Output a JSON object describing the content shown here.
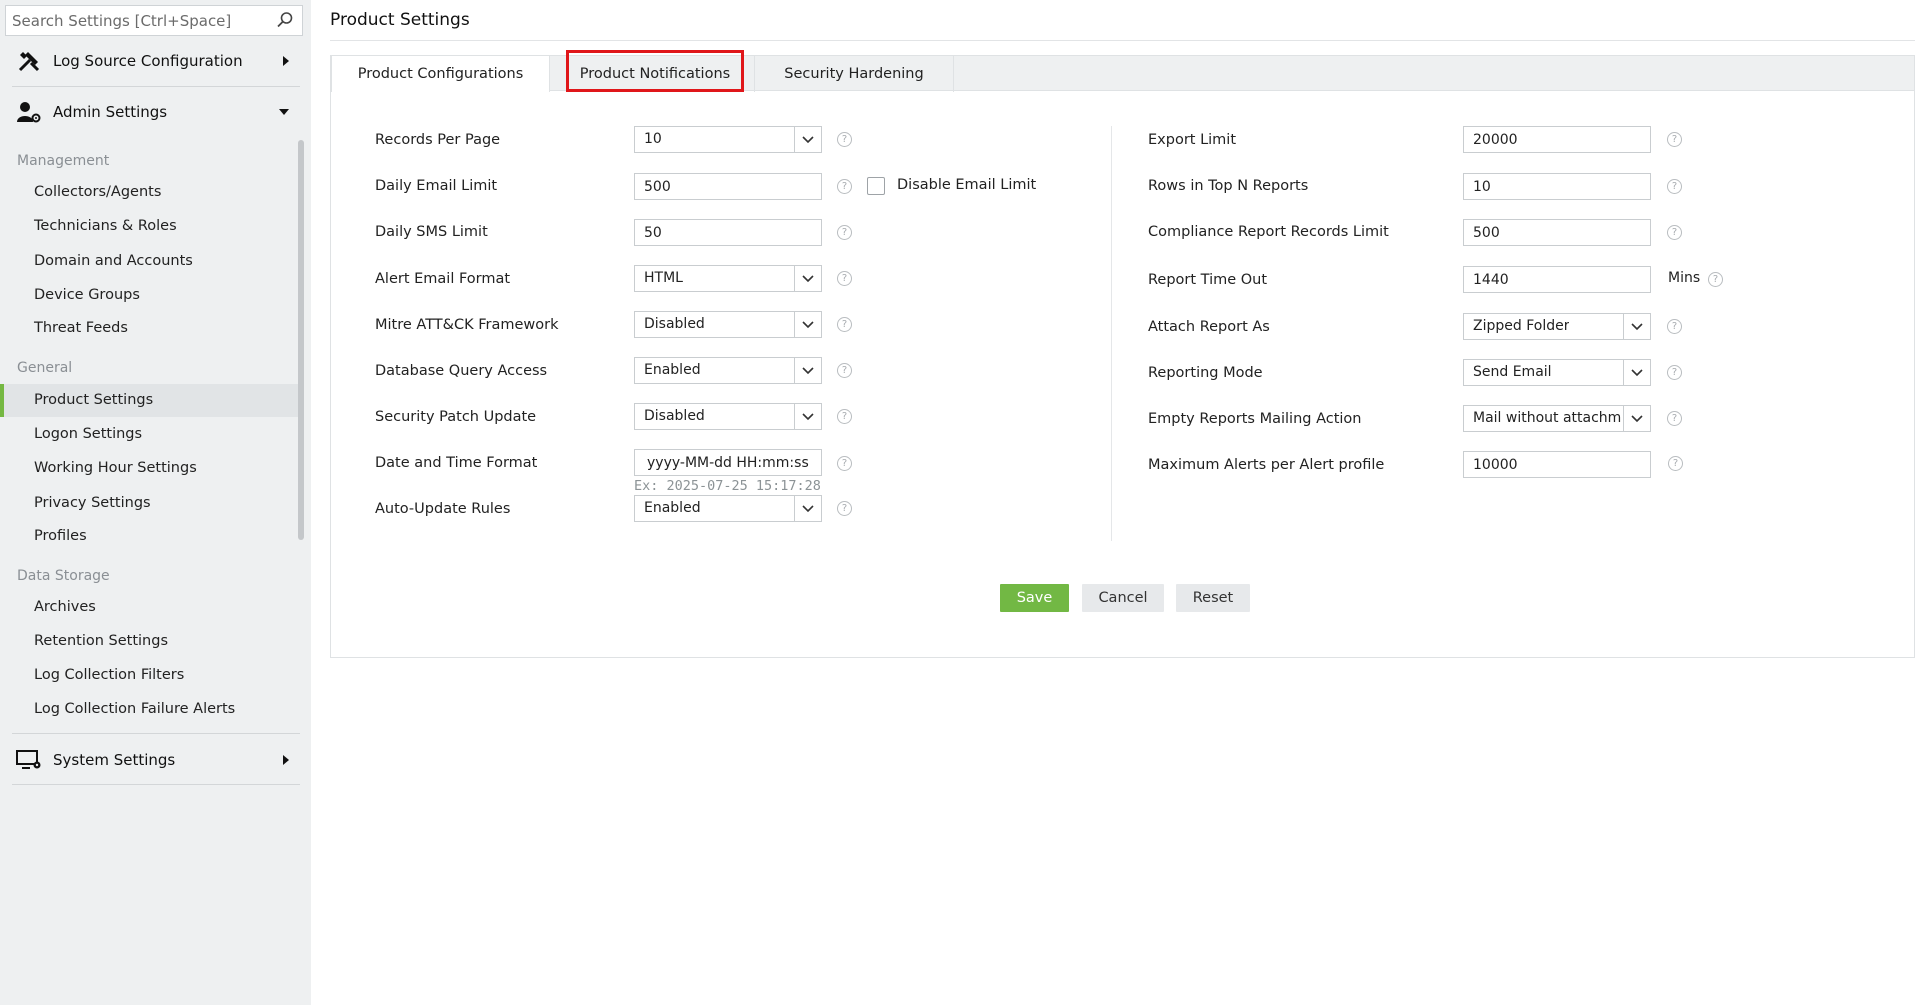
{
  "search": {
    "placeholder": "Search Settings [Ctrl+Space]"
  },
  "sidebar": {
    "log_source": {
      "label": "Log Source Configuration",
      "icon": "tools-icon"
    },
    "admin": {
      "label": "Admin Settings",
      "icon": "user-gear-icon"
    },
    "system": {
      "label": "System Settings",
      "icon": "monitor-gear-icon"
    },
    "sections": [
      {
        "label": "Management",
        "items": [
          "Collectors/Agents",
          "Technicians & Roles",
          "Domain and Accounts",
          "Device Groups",
          "Threat Feeds"
        ]
      },
      {
        "label": "General",
        "items": [
          "Product Settings",
          "Logon Settings",
          "Working Hour Settings",
          "Privacy Settings",
          "Profiles"
        ]
      },
      {
        "label": "Data Storage",
        "items": [
          "Archives",
          "Retention Settings",
          "Log Collection Filters",
          "Log Collection Failure Alerts"
        ]
      }
    ],
    "active_item": "Product Settings"
  },
  "page": {
    "title": "Product Settings"
  },
  "tabs": [
    "Product Configurations",
    "Product Notifications",
    "Security Hardening"
  ],
  "left_form": {
    "records_per_page": {
      "label": "Records Per Page",
      "value": "10"
    },
    "daily_email_limit": {
      "label": "Daily Email Limit",
      "value": "500",
      "checkbox_label": "Disable Email Limit",
      "checked": false
    },
    "daily_sms_limit": {
      "label": "Daily SMS Limit",
      "value": "50"
    },
    "alert_email_format": {
      "label": "Alert Email Format",
      "value": "HTML"
    },
    "mitre": {
      "label": "Mitre ATT&CK Framework",
      "value": "Disabled"
    },
    "db_query": {
      "label": "Database Query Access",
      "value": "Enabled"
    },
    "security_patch": {
      "label": "Security Patch Update",
      "value": "Disabled"
    },
    "date_format": {
      "label": "Date and Time Format",
      "value": "yyyy-MM-dd HH:mm:ss",
      "example": "Ex: 2025-07-25 15:17:28"
    },
    "auto_update": {
      "label": "Auto-Update Rules",
      "value": "Enabled"
    }
  },
  "right_form": {
    "export_limit": {
      "label": "Export Limit",
      "value": "20000"
    },
    "rows_top_n": {
      "label": "Rows in Top N Reports",
      "value": "10"
    },
    "compliance_limit": {
      "label": "Compliance Report Records Limit",
      "value": "500"
    },
    "report_timeout": {
      "label": "Report Time Out",
      "value": "1440",
      "unit": "Mins"
    },
    "attach_report": {
      "label": "Attach Report As",
      "value": "Zipped Folder"
    },
    "reporting_mode": {
      "label": "Reporting Mode",
      "value": "Send Email"
    },
    "empty_reports": {
      "label": "Empty Reports Mailing Action",
      "value": "Mail without attachm"
    },
    "max_alerts": {
      "label": "Maximum Alerts per Alert profile",
      "value": "10000"
    }
  },
  "help_glyph": "?",
  "buttons": {
    "save": "Save",
    "cancel": "Cancel",
    "reset": "Reset"
  },
  "colors": {
    "accent": "#72b844",
    "highlight": "#e0161a",
    "sidebar_bg": "#eef0f1"
  }
}
